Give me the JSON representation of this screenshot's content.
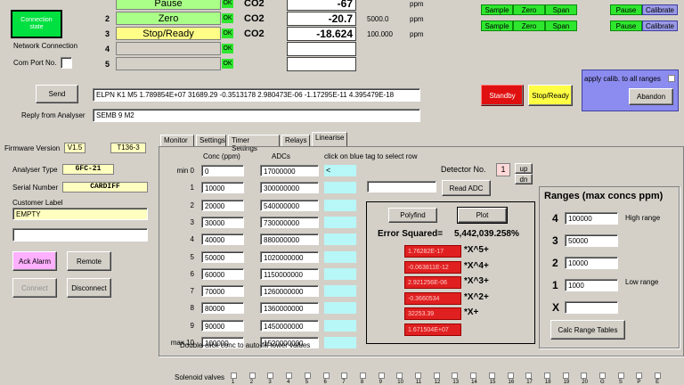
{
  "connection": {
    "status": "Connection state",
    "label": "Network Connection",
    "comport": "Com Port No."
  },
  "gas_rows": [
    {
      "num": "",
      "name": "Pause",
      "ok": "OK",
      "gas": "CO2",
      "value": "-67",
      "conc": "",
      "unit": "ppm",
      "color": "#aaff88"
    },
    {
      "num": "2",
      "name": "Zero",
      "ok": "OK",
      "gas": "CO2",
      "value": "-20.7",
      "conc": "5000.0",
      "unit": "ppm",
      "color": "#aaff88"
    },
    {
      "num": "3",
      "name": "Stop/Ready",
      "ok": "OK",
      "gas": "CO2",
      "value": "-18.624",
      "conc": "100.000",
      "unit": "ppm",
      "color": "#ffff88"
    },
    {
      "num": "4",
      "name": "",
      "ok": "OK",
      "gas": "",
      "value": "",
      "conc": "",
      "unit": "",
      "color": "#d4d0c8"
    },
    {
      "num": "5",
      "name": "",
      "ok": "OK",
      "gas": "",
      "value": "",
      "conc": "",
      "unit": "",
      "color": "#d4d0c8"
    }
  ],
  "top_buttons": {
    "sample": "Sample",
    "zero": "Zero",
    "span": "Span",
    "pause": "Pause",
    "calibrate": "Calibrate"
  },
  "send": {
    "label": "Send",
    "command": "ELPN K1 M5 1.789854E+07 31689.29 -0.3513178 2.980473E-06 -1.17295E-11 4.395479E-18",
    "reply_label": "Reply from Analyser",
    "reply": "SEMB 9  M2"
  },
  "controls": {
    "standby": "Standby",
    "stop_ready": "Stop/Ready",
    "apply_calib": "apply calib. to all ranges",
    "abandon": "Abandon"
  },
  "left": {
    "firmware_label": "Firmware Version",
    "firmware": "V1.5",
    "firmware2": "T136-3",
    "analyser_type_label": "Analyser Type",
    "analyser_type": "GFC-21",
    "serial_label": "Serial Number",
    "serial": "CARDIFF",
    "customer_label": "Customer Label",
    "customer": "EMPTY",
    "ack_alarm": "Ack Alarm",
    "remote": "Remote",
    "connect": "Connect",
    "disconnect": "Disconnect"
  },
  "tabs": [
    "Monitor",
    "Settings",
    "Timer Settings",
    "Relays",
    "Linearise"
  ],
  "linearise": {
    "conc_header": "Conc (ppm)",
    "adc_header": "ADCs",
    "click_hint": "click on blue tag to select row",
    "detector_label": "Detector No.",
    "detector": "1",
    "up": "up",
    "dn": "dn",
    "read_adc": "Read ADC",
    "footer": "Double-click conc to auto-fill lower values",
    "rows": [
      {
        "label": "min  0",
        "conc": "0",
        "adc": "17000000",
        "tag": "<"
      },
      {
        "label": "1",
        "conc": "10000",
        "adc": "300000000",
        "tag": ""
      },
      {
        "label": "2",
        "conc": "20000",
        "adc": "540000000",
        "tag": ""
      },
      {
        "label": "3",
        "conc": "30000",
        "adc": "730000000",
        "tag": ""
      },
      {
        "label": "4",
        "conc": "40000",
        "adc": "880000000",
        "tag": ""
      },
      {
        "label": "5",
        "conc": "50000",
        "adc": "1020000000",
        "tag": ""
      },
      {
        "label": "6",
        "conc": "60000",
        "adc": "1150000000",
        "tag": ""
      },
      {
        "label": "7",
        "conc": "70000",
        "adc": "1260000000",
        "tag": ""
      },
      {
        "label": "8",
        "conc": "80000",
        "adc": "1360000000",
        "tag": ""
      },
      {
        "label": "9",
        "conc": "90000",
        "adc": "1450000000",
        "tag": ""
      },
      {
        "label": "max 10",
        "conc": "100000",
        "adc": "1520000000",
        "tag": ""
      }
    ]
  },
  "fit": {
    "polyfind": "Polyfind",
    "plot": "Plot",
    "error_label": "Error Squared=",
    "error_value": "5,442,039.258%",
    "coeffs": [
      {
        "value": "1.76282E-17",
        "suffix": "*X^5+"
      },
      {
        "value": "-0.063811E-12",
        "suffix": "*X^4+"
      },
      {
        "value": "2.921256E-06",
        "suffix": "*X^3+"
      },
      {
        "value": "-0.3660534",
        "suffix": "*X^2+"
      },
      {
        "value": "32253.39",
        "suffix": "*X+"
      },
      {
        "value": "1.671504E+07",
        "suffix": ""
      }
    ]
  },
  "ranges": {
    "title": "Ranges (max concs ppm)",
    "high": "High range",
    "low": "Low range",
    "rows": [
      {
        "num": "4",
        "value": "100000"
      },
      {
        "num": "3",
        "value": "50000"
      },
      {
        "num": "2",
        "value": "10000"
      },
      {
        "num": "1",
        "value": "1000"
      },
      {
        "num": "X",
        "value": ""
      }
    ],
    "calc": "Calc Range Tables"
  },
  "solenoid": {
    "label": "Solenoid valves",
    "valves": [
      "1",
      "2",
      "3",
      "4",
      "5",
      "6",
      "7",
      "8",
      "9",
      "10",
      "11",
      "12",
      "13",
      "14",
      "15",
      "16",
      "17",
      "18",
      "19",
      "20",
      "G",
      "S",
      "P",
      "E"
    ]
  }
}
